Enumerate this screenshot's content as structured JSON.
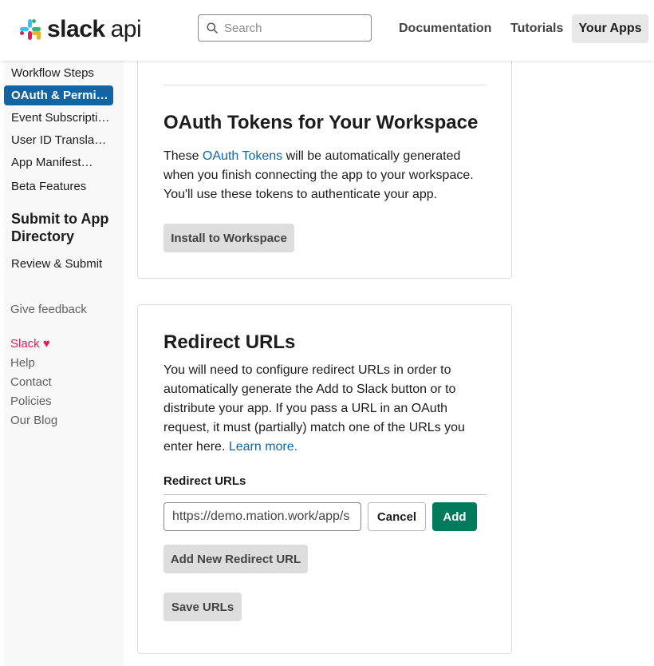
{
  "header": {
    "logo_text": "slack",
    "logo_suffix": "api",
    "search_placeholder": "Search",
    "nav": [
      "Documentation",
      "Tutorials",
      "Your Apps"
    ]
  },
  "sidebar": {
    "items_top": [
      "Workflow Steps",
      "OAuth & Permi…",
      "Event Subscripti…",
      "User ID Transla…",
      "App Manifest…",
      "Beta Features"
    ],
    "section_heading": "Submit to App Directory",
    "review_item": "Review & Submit",
    "feedback": "Give feedback",
    "footer": {
      "slack": "Slack",
      "heart": "♥",
      "links": [
        "Help",
        "Contact",
        "Policies",
        "Our Blog"
      ]
    }
  },
  "tokens_card": {
    "title": "OAuth Tokens for Your Workspace",
    "text_before": "These ",
    "link": "OAuth Tokens",
    "text_after": " will be automatically generated when you finish connecting the app to your workspace. You'll use these tokens to authenticate your app.",
    "install_button": "Install to Workspace"
  },
  "redirect_card": {
    "title": "Redirect URLs",
    "text": "You will need to configure redirect URLs in order to automatically generate the Add to Slack button or to distribute your app. If you pass a URL in an OAuth request, it must (partially) match one of the URLs you enter here. ",
    "learn_more": "Learn more.",
    "field_label": "Redirect URLs",
    "url_value": "https://demo.mation.work/app/s",
    "cancel_button": "Cancel",
    "add_button": "Add",
    "add_new_button": "Add New Redirect URL",
    "save_button": "Save URLs"
  },
  "colors": {
    "accent": "#1264a3",
    "add_green": "#007a5a",
    "slack_pink": "#e01e5a"
  }
}
